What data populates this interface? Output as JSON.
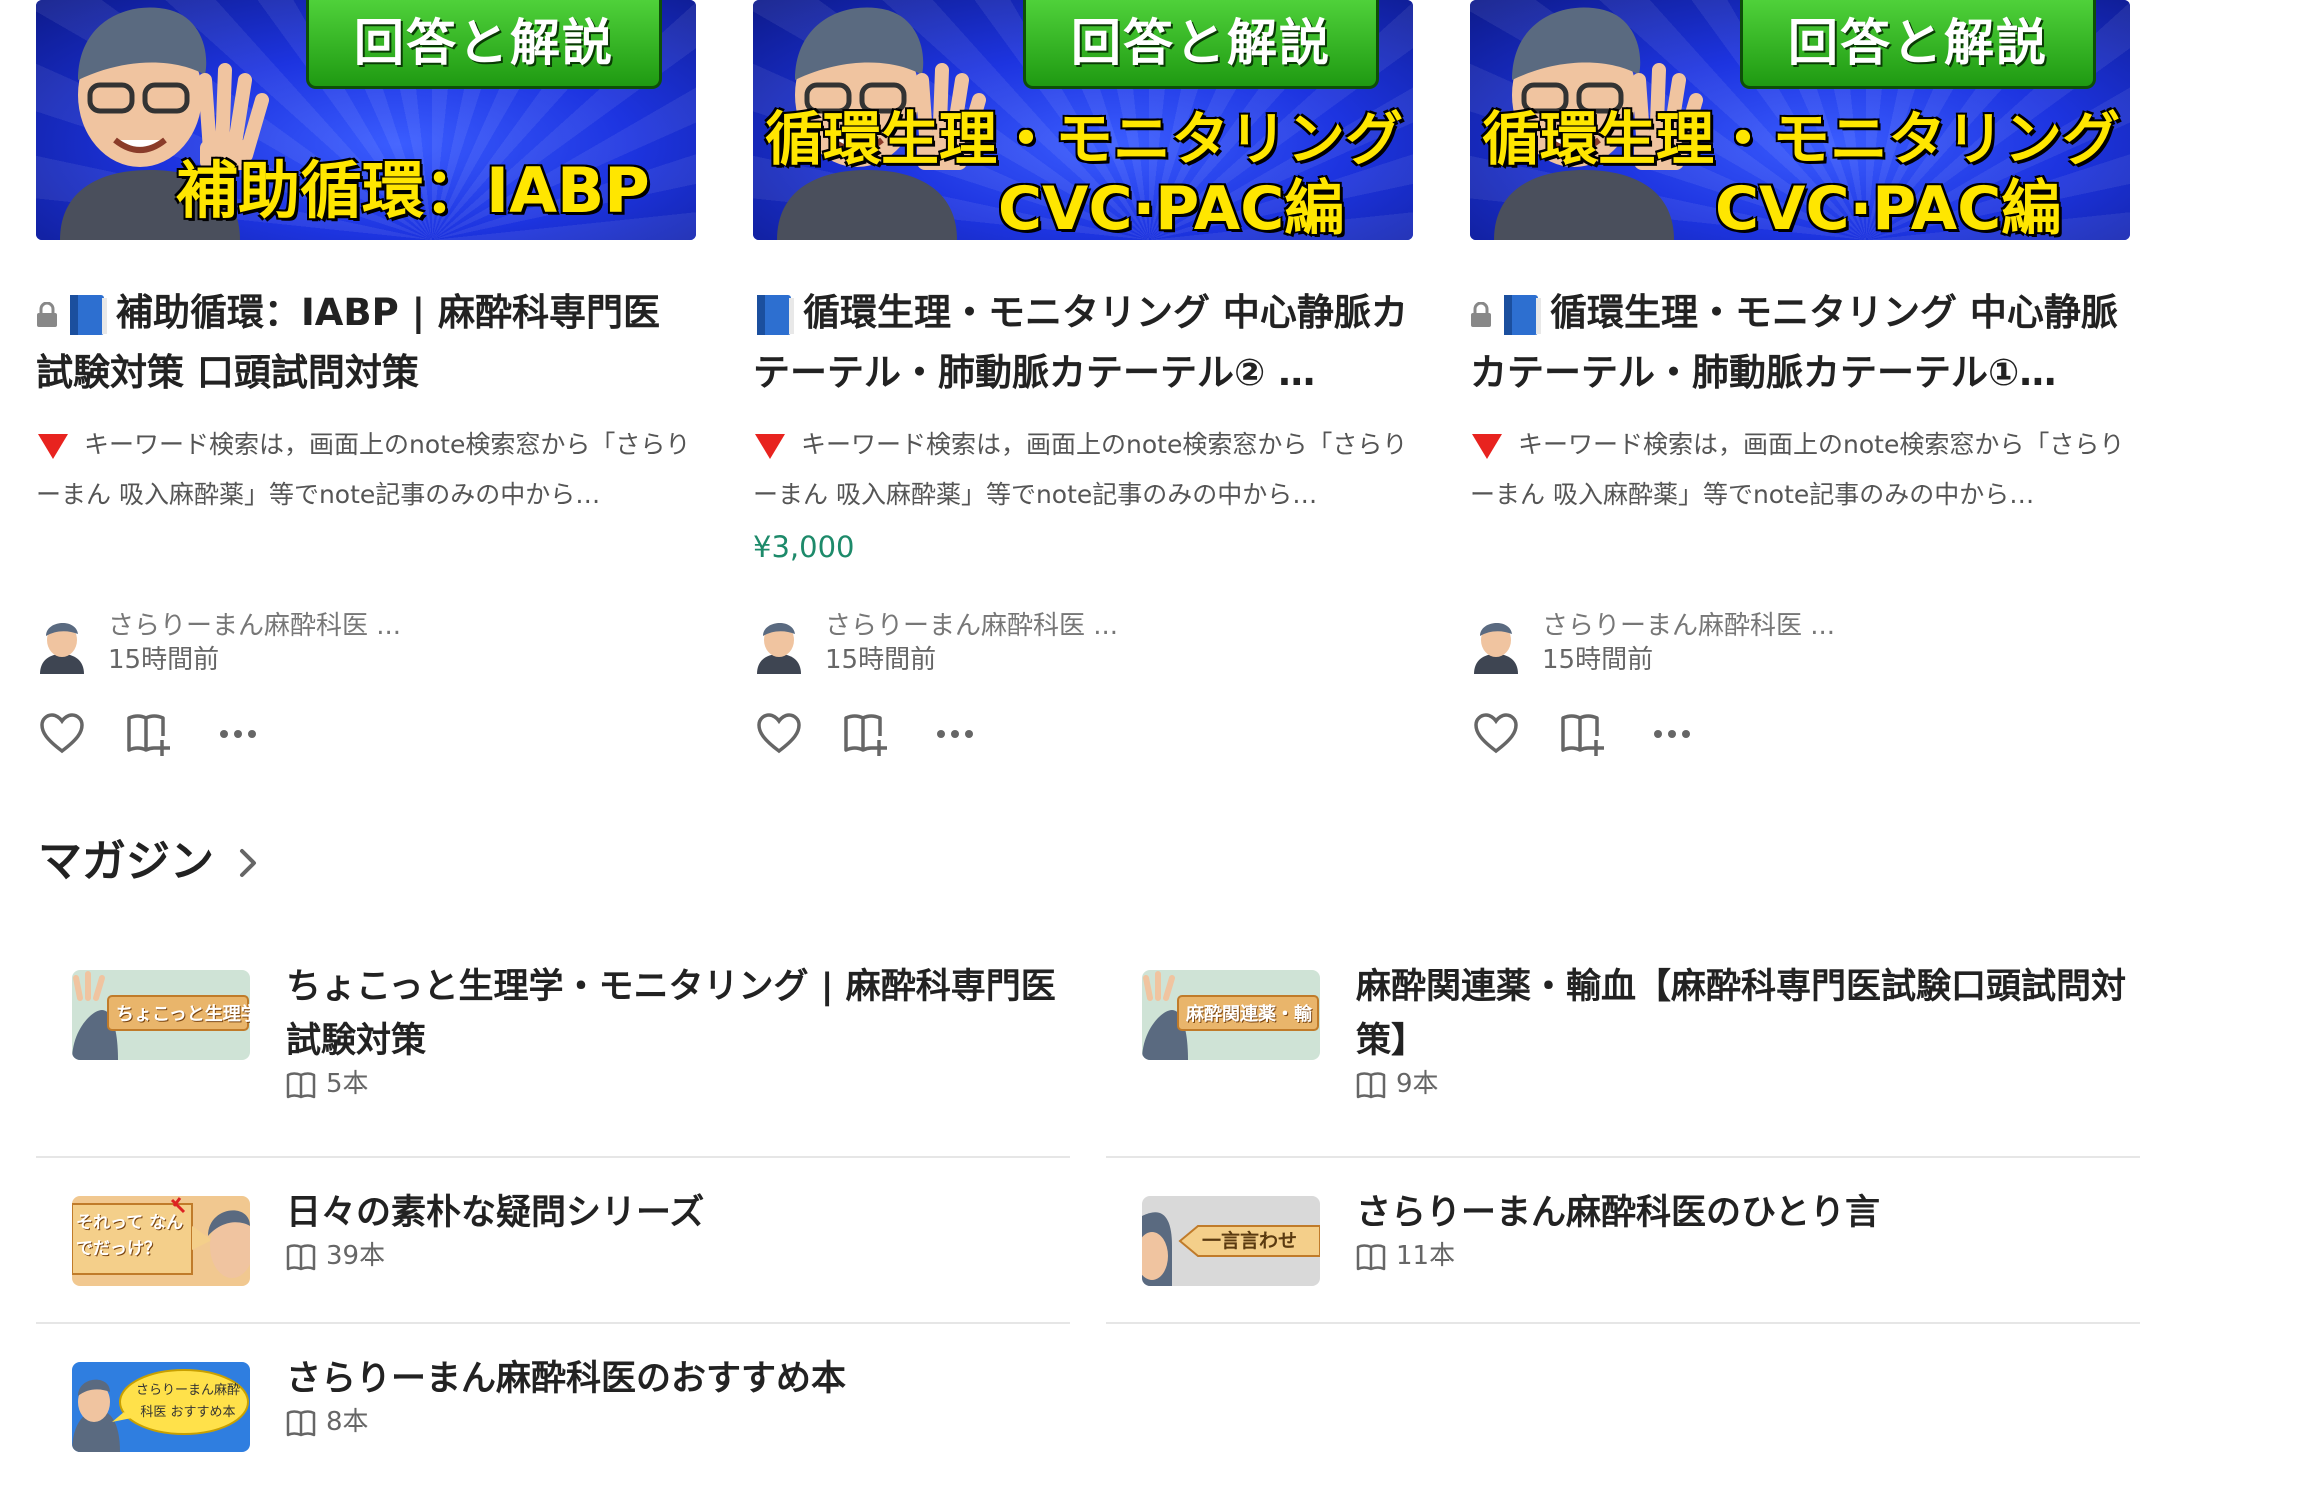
{
  "cards": [
    {
      "locked": true,
      "thumb": {
        "badge": "回答と解説",
        "line1": "補助循環：IABP",
        "line2": ""
      },
      "title": "補助循環：IABP | 麻酔科専門医試験対策 口頭試問対策",
      "desc": "キーワード検索は，画面上のnote検索窓から「さらりーまん 吸入麻酔薬」等でnote記事のみの中から…",
      "price": "",
      "author": "さらりーまん麻酔科医 ...",
      "time": "15時間前"
    },
    {
      "locked": false,
      "thumb": {
        "badge": "回答と解説",
        "line1": "循環生理・モニタリング",
        "line2": "CVC·PAC編"
      },
      "title": "循環生理・モニタリング 中心静脈カテーテル・肺動脈カテーテル② …",
      "desc": "キーワード検索は，画面上のnote検索窓から「さらりーまん 吸入麻酔薬」等でnote記事のみの中から…",
      "price": "¥3,000",
      "author": "さらりーまん麻酔科医 ...",
      "time": "15時間前"
    },
    {
      "locked": true,
      "thumb": {
        "badge": "回答と解説",
        "line1": "循環生理・モニタリング",
        "line2": "CVC·PAC編"
      },
      "title": "循環生理・モニタリング 中心静脈カテーテル・肺動脈カテーテル①…",
      "desc": "キーワード検索は，画面上のnote検索窓から「さらりーまん 吸入麻酔薬」等でnote記事のみの中から…",
      "price": "",
      "author": "さらりーまん麻酔科医 ...",
      "time": "15時間前"
    }
  ],
  "section": {
    "title": "マガジン"
  },
  "magazines": [
    {
      "title": "ちょこっと生理学・モニタリング | 麻酔科専門医試験対策",
      "count": "5本",
      "thumb_text": "ちょこっと生理学",
      "thumb_bg": "#cfe3d6"
    },
    {
      "title": "麻酔関連薬・輸血【麻酔科専門医試験口頭試問対策】",
      "count": "9本",
      "thumb_text": "麻酔関連薬・輸",
      "thumb_bg": "#cfe3d6"
    },
    {
      "title": "日々の素朴な疑問シリーズ",
      "count": "39本",
      "thumb_text": "それって なんでだっけ？",
      "thumb_bg": "#f1c890"
    },
    {
      "title": "さらりーまん麻酔科医のひとり言",
      "count": "11本",
      "thumb_text": "一言言わせ",
      "thumb_bg": "#d9d9d9"
    },
    {
      "title": "さらりーまん麻酔科医のおすすめ本",
      "count": "8本",
      "thumb_text": "さらりーまん麻酔科医 おすすめ本",
      "thumb_bg": "#2f7ee0"
    }
  ],
  "colors": {
    "price": "#1d8a6a",
    "badge_green": "#2fae1e",
    "thumb_blue": "#1d34e0",
    "thumb_yellow": "#ffe600"
  }
}
